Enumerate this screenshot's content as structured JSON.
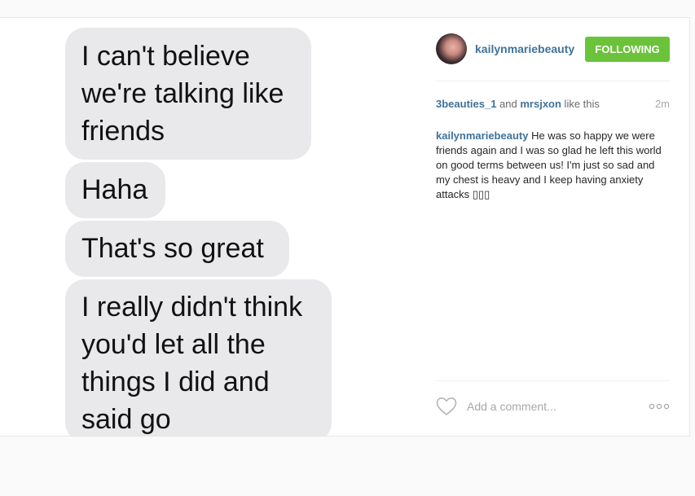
{
  "messages": [
    {
      "lines": [
        "I can't believe",
        "we're talking like",
        "friends"
      ]
    },
    {
      "lines": [
        "Haha"
      ]
    },
    {
      "lines": [
        "That's so great"
      ]
    },
    {
      "lines": [
        "I really didn't think",
        "you'd let all the",
        "things I did and",
        "said go"
      ]
    }
  ],
  "post": {
    "username": "kailynmariebeauty",
    "follow_label": "FOLLOWING",
    "likes": {
      "user1": "3beauties_1",
      "connector": " and ",
      "user2": "mrsjxon",
      "suffix": " like this"
    },
    "timestamp": "2m",
    "caption_user": "kailynmariebeauty",
    "caption_text": "He was so happy we were friends again and I was so glad he left this world on good terms between us! I'm just so sad and my chest is heavy and I keep having anxiety attacks ▯▯▯",
    "comment_placeholder": "Add a comment...",
    "more_icon": "more-options-icon",
    "like_icon": "heart-icon"
  },
  "colors": {
    "link": "#3f729b",
    "follow_button": "#6bc33b",
    "bubble": "#e9e9eb"
  }
}
